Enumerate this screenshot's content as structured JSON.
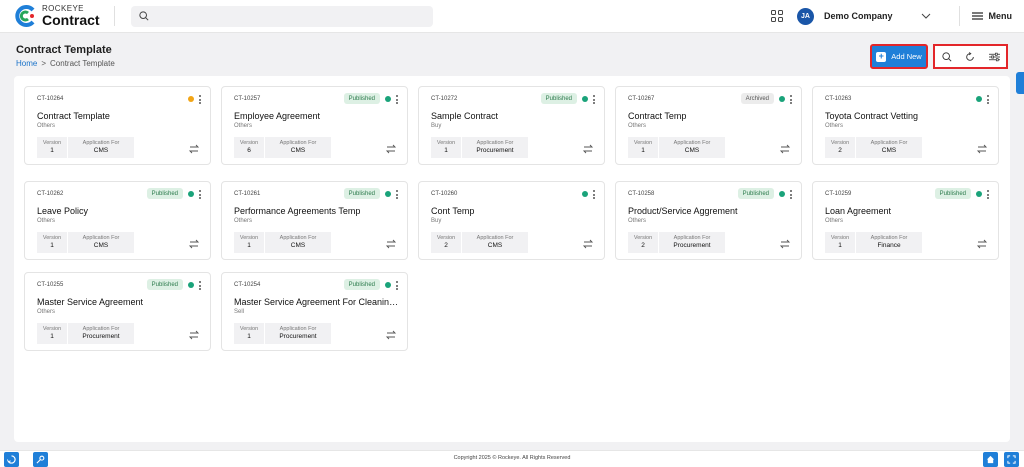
{
  "header": {
    "logo_top": "ROCKEYE",
    "logo_bottom": "Contract",
    "avatar_initials": "JA",
    "company": "Demo Company",
    "menu_label": "Menu"
  },
  "page": {
    "title": "Contract Template",
    "breadcrumb": [
      "Home",
      ">",
      "Contract Template"
    ],
    "add_new_label": "Add New"
  },
  "labels": {
    "version": "Version",
    "application_for": "Application For"
  },
  "status_colors": {
    "published": "#1aa37a",
    "draft": "#f2a516",
    "archived": "#1aa37a"
  },
  "cards": [
    {
      "code": "CT-10264",
      "status": "",
      "dot": "#f2a516",
      "name": "Contract Template",
      "category": "Others",
      "version": "1",
      "application": "CMS"
    },
    {
      "code": "CT-10257",
      "status": "Published",
      "dot": "#1aa37a",
      "name": "Employee Agreement",
      "category": "Others",
      "version": "6",
      "application": "CMS"
    },
    {
      "code": "CT-10272",
      "status": "Published",
      "dot": "#1aa37a",
      "name": "Sample Contract",
      "category": "Buy",
      "version": "1",
      "application": "Procurement"
    },
    {
      "code": "CT-10267",
      "status": "Archived",
      "dot": "#1aa37a",
      "name": "Contract Temp",
      "category": "Others",
      "version": "1",
      "application": "CMS"
    },
    {
      "code": "CT-10263",
      "status": "",
      "dot": "#1aa37a",
      "name": "Toyota Contract Vetting",
      "category": "Others",
      "version": "2",
      "application": "CMS"
    },
    {
      "code": "CT-10262",
      "status": "Published",
      "dot": "#1aa37a",
      "name": "Leave Policy",
      "category": "Others",
      "version": "1",
      "application": "CMS"
    },
    {
      "code": "CT-10261",
      "status": "Published",
      "dot": "#1aa37a",
      "name": "Performance Agreements Temp",
      "category": "Others",
      "version": "1",
      "application": "CMS"
    },
    {
      "code": "CT-10260",
      "status": "",
      "dot": "#1aa37a",
      "name": "Cont Temp",
      "category": "Buy",
      "version": "2",
      "application": "CMS"
    },
    {
      "code": "CT-10258",
      "status": "Published",
      "dot": "#1aa37a",
      "name": "Product/Service Aggrement",
      "category": "Others",
      "version": "2",
      "application": "Procurement"
    },
    {
      "code": "CT-10259",
      "status": "Published",
      "dot": "#1aa37a",
      "name": "Loan Agreement",
      "category": "Others",
      "version": "1",
      "application": "Finance"
    },
    {
      "code": "CT-10255",
      "status": "Published",
      "dot": "#1aa37a",
      "name": "Master Service Agreement",
      "category": "Others",
      "version": "1",
      "application": "Procurement"
    },
    {
      "code": "CT-10254",
      "status": "Published",
      "dot": "#1aa37a",
      "name": "Master Service Agreement For Cleaning Services",
      "category": "Sell",
      "version": "1",
      "application": "Procurement"
    }
  ],
  "footer": {
    "copyright": "Copyright 2025 © Rockeye. All Rights Reserved"
  }
}
